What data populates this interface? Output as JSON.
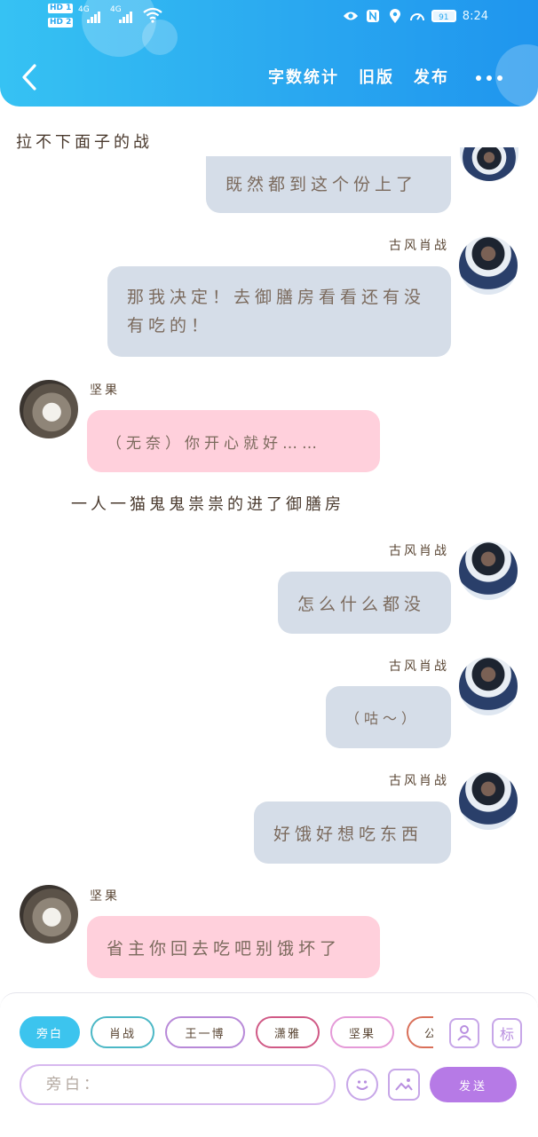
{
  "status_bar": {
    "hd1": "HD 1",
    "hd2": "HD 2",
    "net1": "4G",
    "net2": "4G",
    "battery": "91",
    "time": "8:24"
  },
  "header": {
    "links": [
      "字数统计",
      "旧版",
      "发布"
    ],
    "back_icon": "chevron-left-icon",
    "more_icon": "more-dots-icon"
  },
  "chat": {
    "narration_top": "拉不下面子的战",
    "cut_bubble": "既然都到这个份上了",
    "messages": [
      {
        "side": "right",
        "name": "古风肖战",
        "text": "那我决定！去御膳房看看还有没有吃的！"
      },
      {
        "side": "left",
        "name": "坚果",
        "text": "（无奈）你开心就好……"
      },
      {
        "side": "narration",
        "text": "一人一猫鬼鬼祟祟的进了御膳房"
      },
      {
        "side": "right",
        "name": "古风肖战",
        "text": "怎么什么都没"
      },
      {
        "side": "right",
        "name": "古风肖战",
        "text": "（咕～）"
      },
      {
        "side": "right",
        "name": "古风肖战",
        "text": "好饿好想吃东西"
      },
      {
        "side": "left",
        "name": "坚果",
        "text": "省主你回去吃吧别饿坏了"
      }
    ]
  },
  "composer": {
    "chips": [
      "旁白",
      "肖战",
      "王一博",
      "潇雅",
      "坚果",
      "公"
    ],
    "input_placeholder": "旁白：",
    "send_label": "发送",
    "tool_icons": [
      "person-card-icon",
      "mark-icon"
    ],
    "tag_label": "标",
    "emoji_icon": "emoji-icon",
    "image_icon": "image-icon"
  },
  "colors": {
    "header": "#2aa8f0",
    "bubble_blue": "#d5dde8",
    "bubble_pink": "#ffd0dc",
    "send": "#b67ae6"
  }
}
